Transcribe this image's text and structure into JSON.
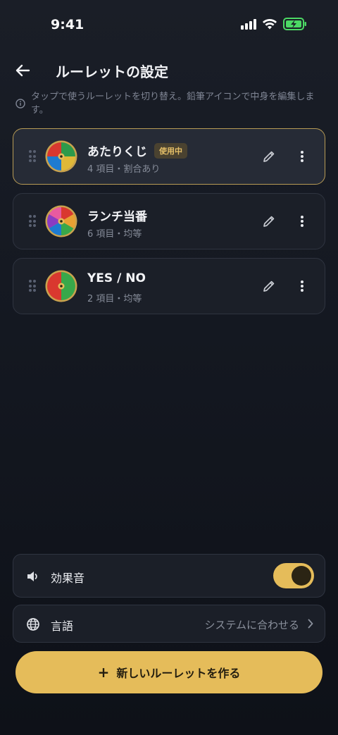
{
  "status_bar": {
    "time": "9:41"
  },
  "header": {
    "title": "ルーレットの設定"
  },
  "hint": "タップで使うルーレットを切り替え。鉛筆アイコンで中身を編集します。",
  "roulettes": [
    {
      "name": "あたりくじ",
      "badge": "使用中",
      "subtitle": "4 項目・割合あり",
      "active": true,
      "colors": [
        "#2d9a4a",
        "#e0b838",
        "#1e7bd0",
        "#d9382f"
      ]
    },
    {
      "name": "ランチ当番",
      "subtitle": "6 項目・均等",
      "colors": [
        "#d9382f",
        "#e8a033",
        "#38a84a",
        "#1e7bd0",
        "#8a3cc2",
        "#e85aa0"
      ]
    },
    {
      "name": "YES / NO",
      "subtitle": "2 項目・均等",
      "colors": [
        "#38a84a",
        "#d9382f"
      ]
    }
  ],
  "settings": {
    "sound": {
      "label": "効果音",
      "enabled": true
    },
    "language": {
      "label": "言語",
      "value": "システムに合わせる"
    }
  },
  "create_button": {
    "icon": "+",
    "label": "新しいルーレットを作る"
  },
  "colors": {
    "accent": "#e5bc5a",
    "background": "#141821"
  }
}
